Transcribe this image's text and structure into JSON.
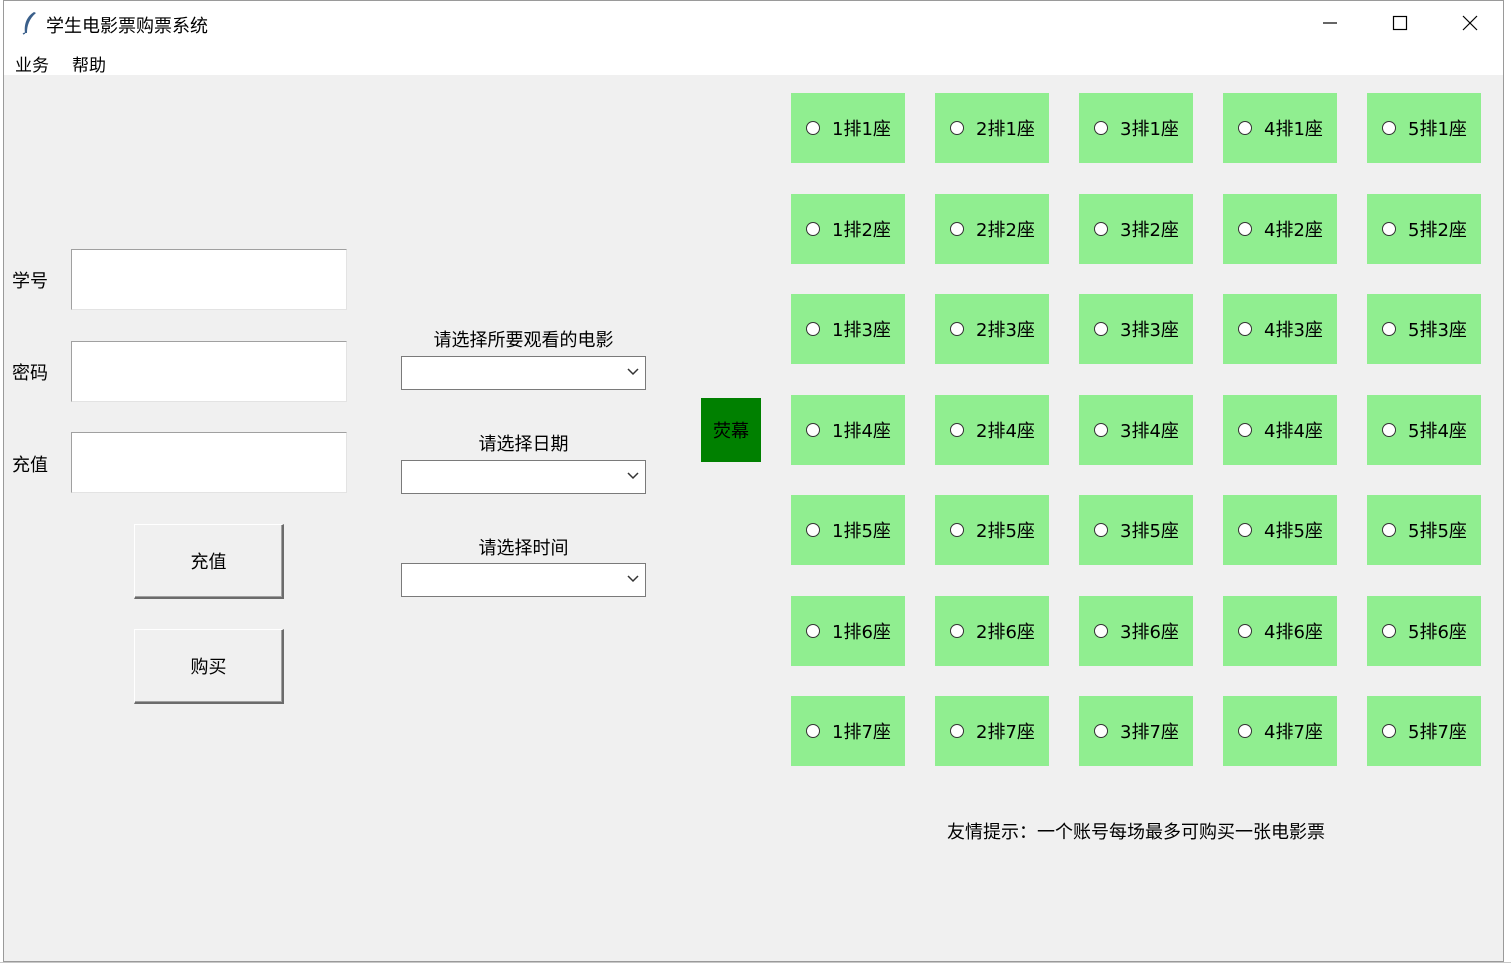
{
  "window": {
    "title": "学生电影票购票系统",
    "app_icon": "feather-icon",
    "controls": [
      "minimize-icon",
      "maximize-icon",
      "close-icon"
    ]
  },
  "menubar": {
    "items": [
      {
        "label": "业务"
      },
      {
        "label": "帮助"
      }
    ]
  },
  "form": {
    "student_id_label": "学号",
    "student_id_value": "",
    "password_label": "密码",
    "password_value": "",
    "recharge_label": "充值",
    "recharge_value": "",
    "recharge_button": "充值",
    "buy_button": "购买"
  },
  "selectors": [
    {
      "label": "请选择所要观看的电影",
      "value": ""
    },
    {
      "label": "请选择日期",
      "value": ""
    },
    {
      "label": "请选择时间",
      "value": ""
    }
  ],
  "screen_label": "荧幕",
  "seat_color": "#90ee90",
  "screen_color": "#008000",
  "seats": [
    [
      "1排1座",
      "2排1座",
      "3排1座",
      "4排1座",
      "5排1座"
    ],
    [
      "1排2座",
      "2排2座",
      "3排2座",
      "4排2座",
      "5排2座"
    ],
    [
      "1排3座",
      "2排3座",
      "3排3座",
      "4排3座",
      "5排3座"
    ],
    [
      "1排4座",
      "2排4座",
      "3排4座",
      "4排4座",
      "5排4座"
    ],
    [
      "1排5座",
      "2排5座",
      "3排5座",
      "4排5座",
      "5排5座"
    ],
    [
      "1排6座",
      "2排6座",
      "3排6座",
      "4排6座",
      "5排6座"
    ],
    [
      "1排7座",
      "2排7座",
      "3排7座",
      "4排7座",
      "5排7座"
    ]
  ],
  "tip": "友情提示：一个账号每场最多可购买一张电影票"
}
